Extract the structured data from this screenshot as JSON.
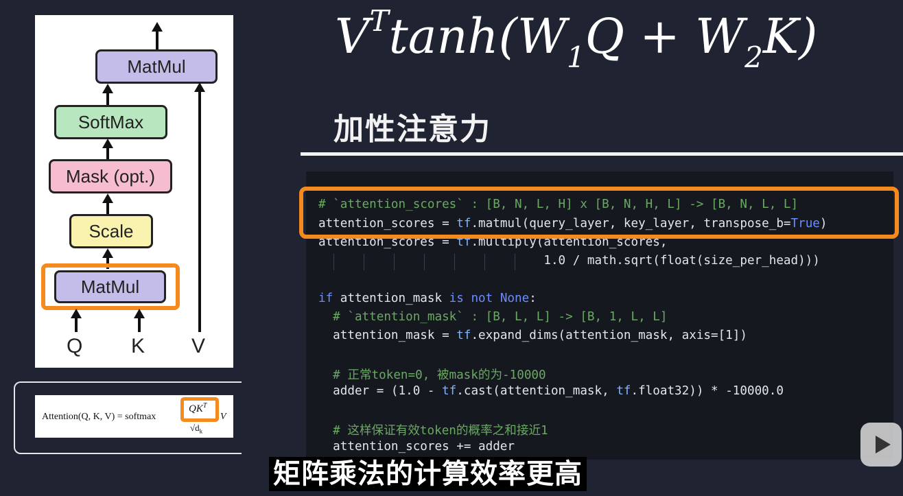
{
  "diagram": {
    "blocks": [
      {
        "label": "MatMul",
        "color": "#c5bde9"
      },
      {
        "label": "SoftMax",
        "color": "#b8e6bf"
      },
      {
        "label": "Mask (opt.)",
        "color": "#f6bcd0"
      },
      {
        "label": "Scale",
        "color": "#faf3b0"
      },
      {
        "label": "MatMul",
        "color": "#c5bde9"
      }
    ],
    "inputs": [
      "Q",
      "K",
      "V"
    ],
    "highlight_color": "#f58a1f"
  },
  "formula_card": {
    "lhs": "Attention(Q, K, V) = softmax",
    "numerator": "QK",
    "numerator_sup": "T",
    "denominator": "√d",
    "denominator_sub": "k",
    "tail": "V"
  },
  "heading": {
    "formula_v": "V",
    "formula_v_sup": "T",
    "formula_tanh": "tanh(W",
    "formula_sub1": "1",
    "formula_mid": "Q + W",
    "formula_sub2": "2",
    "formula_end": "K)",
    "subtitle": "加性注意力"
  },
  "code": {
    "lines": [
      {
        "type": "comment",
        "text": "# `attention_scores` : [B, N, L, H] x [B, N, H, L] -> [B, N, L, L]"
      },
      {
        "type": "code",
        "text": "attention_scores = tf.matmul(query_layer, key_layer, transpose_b=True)"
      },
      {
        "type": "code",
        "text": "attention_scores = tf.multiply(attention_scores,"
      },
      {
        "type": "code",
        "text": "                               1.0 / math.sqrt(float(size_per_head)))"
      },
      {
        "type": "code",
        "text": "if attention_mask is not None:"
      },
      {
        "type": "comment",
        "text": "  # `attention_mask` : [B, L, L] -> [B, 1, L, L]"
      },
      {
        "type": "code",
        "text": "  attention_mask = tf.expand_dims(attention_mask, axis=[1])"
      },
      {
        "type": "comment",
        "text": "  # 正常token=0, 被mask的为-10000"
      },
      {
        "type": "code",
        "text": "  adder = (1.0 - tf.cast(attention_mask, tf.float32)) * -10000.0"
      },
      {
        "type": "comment",
        "text": "  # 这样保证有效token的概率之和接近1"
      },
      {
        "type": "code",
        "text": "  attention_scores += adder"
      }
    ]
  },
  "caption": "矩阵乘法的计算效率更高",
  "colors": {
    "background": "#1f2332",
    "code_bg": "#161820",
    "comment": "#6aa863",
    "keyword": "#6b8cff",
    "highlight": "#f58a1f"
  }
}
